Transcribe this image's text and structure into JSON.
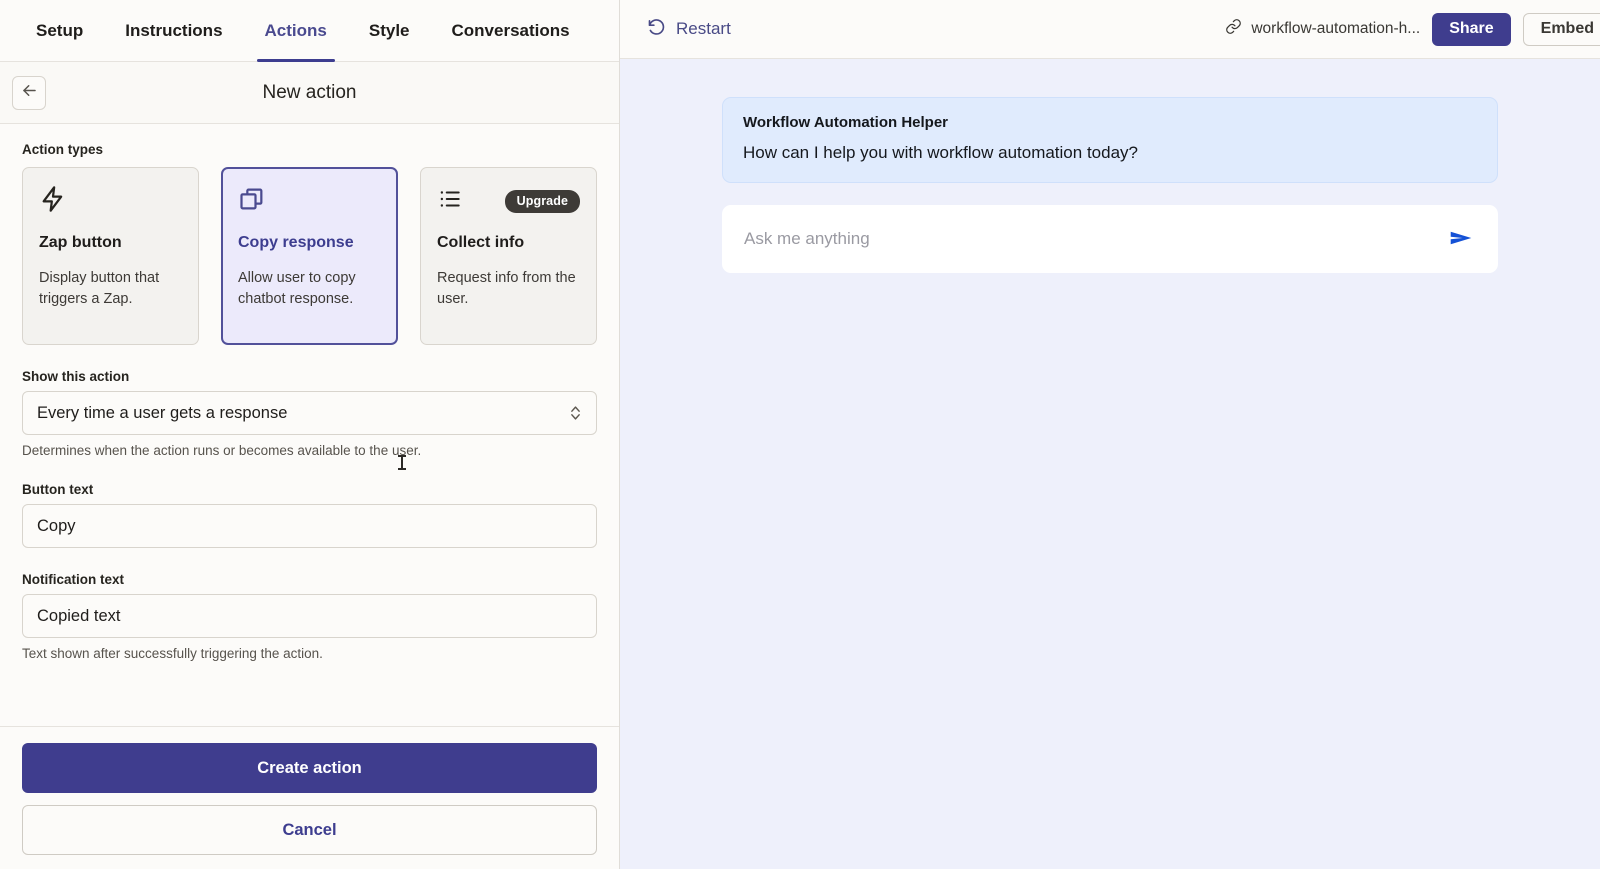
{
  "tabs": [
    {
      "label": "Setup",
      "active": false
    },
    {
      "label": "Instructions",
      "active": false
    },
    {
      "label": "Actions",
      "active": true
    },
    {
      "label": "Style",
      "active": false
    },
    {
      "label": "Conversations",
      "active": false
    }
  ],
  "panel": {
    "title": "New action",
    "back_icon": "arrow-left-icon",
    "section_label": "Action types",
    "action_types": [
      {
        "icon": "lightning-bolt-icon",
        "title": "Zap button",
        "description": "Display button that triggers a Zap.",
        "selected": false,
        "badge": null
      },
      {
        "icon": "copy-icon",
        "title": "Copy response",
        "description": "Allow user to copy chatbot response.",
        "selected": true,
        "badge": null
      },
      {
        "icon": "list-icon",
        "title": "Collect info",
        "description": "Request info from the user.",
        "selected": false,
        "badge": "Upgrade"
      }
    ],
    "fields": [
      {
        "label": "Show this action",
        "value": "Every time a user gets a response",
        "help": "Determines when the action runs or becomes available to the user.",
        "type": "select"
      },
      {
        "label": "Button text",
        "value": "Copy",
        "help": "",
        "type": "text"
      },
      {
        "label": "Notification text",
        "value": "Copied text",
        "help": "Text shown after successfully triggering the action.",
        "type": "text"
      }
    ],
    "create_label": "Create action",
    "cancel_label": "Cancel"
  },
  "preview": {
    "restart_label": "Restart",
    "restart_icon": "restart-icon",
    "url_icon": "link-icon",
    "url_text": "workflow-automation-h...",
    "share_label": "Share",
    "embed_label": "Embed",
    "message": {
      "sender": "Workflow Automation Helper",
      "text": "How can I help you with workflow automation today?"
    },
    "composer": {
      "placeholder": "Ask me anything",
      "value": "",
      "send_icon": "send-icon"
    }
  },
  "colors": {
    "accent": "#3f3d8e",
    "accent_text": "#3d3d8f",
    "card_selected_bg": "#eceafb",
    "badge_bg": "#3e3b37",
    "bubble_bg": "#e0ebfd",
    "preview_bg": "#eef0fb",
    "send_blue": "#1451d6"
  }
}
